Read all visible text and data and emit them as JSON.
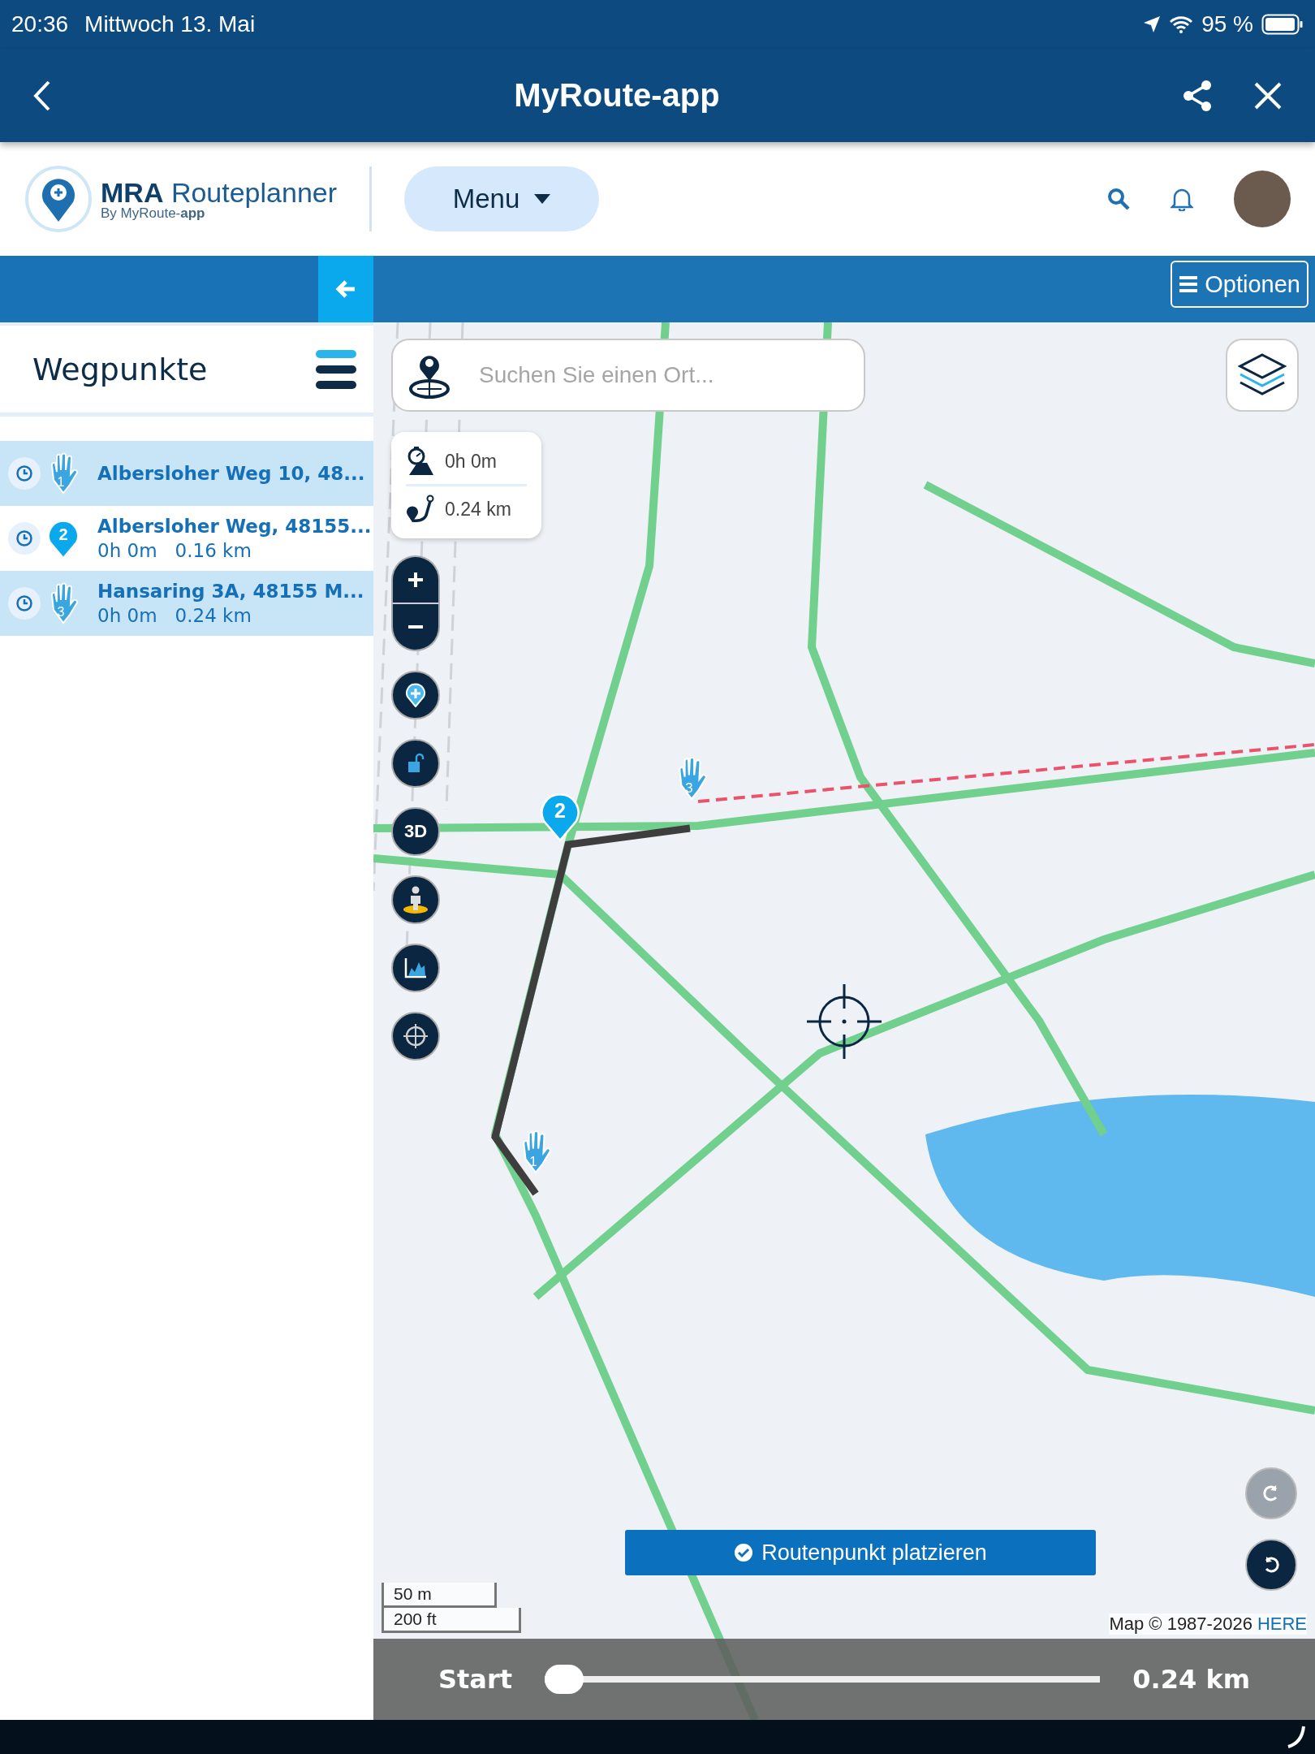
{
  "status_bar": {
    "time": "20:36",
    "date": "Mittwoch 13. Mai",
    "battery": "95 %"
  },
  "app_bar": {
    "title": "MyRoute-app"
  },
  "top_bar": {
    "logo_title": "MRA",
    "logo_subtitle": "Routeplanner",
    "logo_byline": "By MyRoute-**app**",
    "menu": "Menu"
  },
  "tool_bar": {
    "options": "Optionen"
  },
  "sidebar": {
    "title": "Wegpunkte",
    "waypoints": [
      {
        "kind": "shaping",
        "number": "1",
        "name": "Albersloher Weg 10, 48...",
        "selected": true
      },
      {
        "kind": "waypoint",
        "number": "2",
        "name": "Albersloher Weg, 48155...",
        "time": "0h 0m",
        "distance": "0.16 km",
        "selected": false
      },
      {
        "kind": "shaping",
        "number": "3",
        "name": "Hansaring 3A, 48155 M...",
        "time": "0h 0m",
        "distance": "0.24 km",
        "selected": true
      }
    ]
  },
  "map": {
    "search": {
      "placeholder": "Suchen Sie einen Ort..."
    },
    "summary": {
      "time": "0h 0m",
      "distance": "0.24 km"
    },
    "tools": [
      {
        "kind": "add"
      },
      {
        "kind": "lock"
      },
      {
        "kind": "label",
        "label": "3D"
      },
      {
        "kind": "person"
      },
      {
        "kind": "profile"
      },
      {
        "kind": "target"
      }
    ],
    "markers": [
      {
        "kind": "waypoint",
        "number": "2"
      },
      {
        "kind": "shaping",
        "number": "3"
      },
      {
        "kind": "shaping",
        "number": "1"
      }
    ],
    "history_buttons": [
      {
        "kind": "redo",
        "disabled": true
      },
      {
        "kind": "undo",
        "disabled": false
      }
    ],
    "place_button": "Routenpunkt platzieren",
    "scale": [
      "50 m",
      "200 ft"
    ],
    "attribution": "Map © 1987-2026",
    "attribution_link": "HERE"
  },
  "slider": {
    "start": "Start",
    "end": "0.24 km",
    "level": 0
  }
}
